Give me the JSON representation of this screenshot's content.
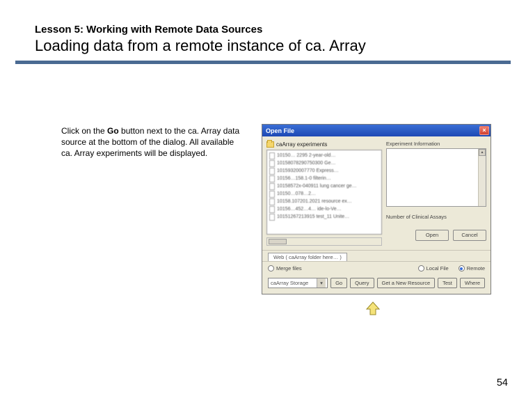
{
  "header": {
    "lesson_label": "Lesson 5: Working with Remote Data Sources",
    "title": "Loading data from a remote instance of ca. Array"
  },
  "instruction": {
    "prefix": "Click on the ",
    "bold": "Go",
    "suffix": " button next to the ca. Array data source at the bottom of the dialog. All available ca. Array experiments will be displayed."
  },
  "dialog": {
    "title": "Open File",
    "close_glyph": "×",
    "folder_label": "caArray experiments",
    "files": [
      "10150… 2295 2-year-old…",
      "10158078290750300 Ge…",
      "10159320007770 Express…",
      "10156…158.1-0 filterin…",
      "10158572x-040911 lung cancer ge…",
      "10150…078…2…",
      "10158.107201.2021 resource ex…",
      "10156…452…4… ide-lo-Ve…",
      "10151267213915 test_11 Unite…"
    ],
    "right_label": "Experiment Information",
    "assay_label": "Number of Clinical Assays",
    "btn_open": "Open",
    "btn_cancel": "Cancel",
    "tab_label": "Web ( caArray folder here… )",
    "merge_label": "Merge files",
    "radio_local": "Local File",
    "radio_remote": "Remote",
    "combo_label": "caArray Storage",
    "btn_go": "Go",
    "btn_query": "Query",
    "btn_newres": "Get a New Resource",
    "btn_test": "Test",
    "btn_where": "Where"
  },
  "page_number": "54"
}
